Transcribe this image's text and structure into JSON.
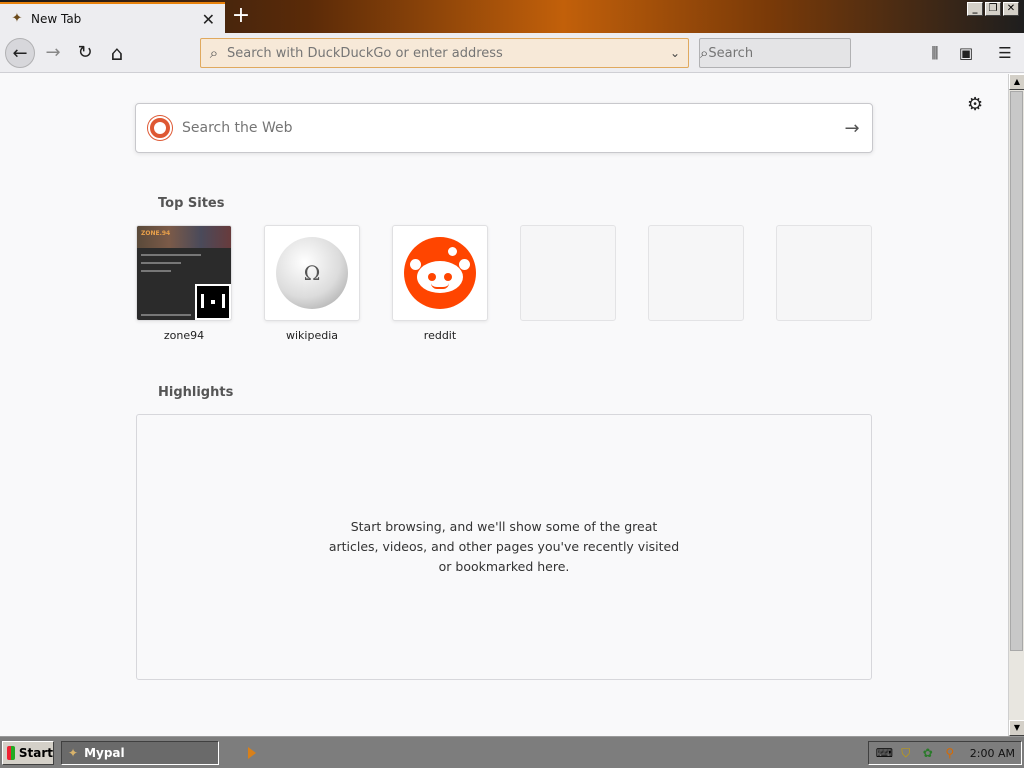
{
  "tab": {
    "title": "New Tab",
    "favicon": "mypal-icon",
    "close_glyph": "✕"
  },
  "newtab_glyph": "+",
  "window": {
    "minimize": "_",
    "restore": "❐",
    "close": "✕"
  },
  "nav": {
    "back": "←",
    "forward": "→",
    "reload": "↻",
    "home": "⌂"
  },
  "urlbar": {
    "placeholder": "Search with DuckDuckGo or enter address",
    "value": ""
  },
  "searchbar": {
    "placeholder": "Search"
  },
  "toolbar": {
    "library": "⫼",
    "sidebar": "▣",
    "menu": "☰"
  },
  "settings_gear": "⚙",
  "websearch": {
    "placeholder": "Search the Web",
    "arrow": "→"
  },
  "top_sites": {
    "title": "Top Sites",
    "sites": [
      {
        "label": "zone94"
      },
      {
        "label": "wikipedia"
      },
      {
        "label": "reddit"
      }
    ],
    "zone_thumb_title": "ZONE.94"
  },
  "wikipedia_glyph": "Ω",
  "highlights": {
    "title": "Highlights",
    "message": "Start browsing, and we'll show some of the great articles, videos, and other pages you've recently visited or bookmarked here."
  },
  "taskbar": {
    "start": "Start",
    "task_label": "Mypal",
    "clock": "2:00 AM"
  },
  "colors": {
    "accent": "#e8820c",
    "ddg": "#de5833",
    "reddit": "#ff4500"
  }
}
